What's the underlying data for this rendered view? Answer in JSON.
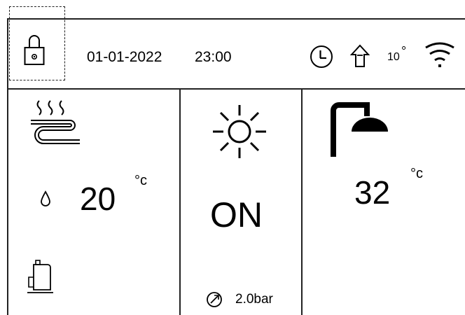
{
  "header": {
    "date": "01-01-2022",
    "time": "23:00",
    "outdoor_temp": "10",
    "outdoor_temp_unit": "°"
  },
  "panels": {
    "floor_heating": {
      "water_temp": "20",
      "unit": "°c"
    },
    "mode": {
      "status": "ON",
      "pressure": "2.0bar"
    },
    "hot_water": {
      "temp": "32",
      "unit": "°c"
    }
  },
  "icons": {
    "lock": "lock-icon",
    "clock": "clock-icon",
    "home": "home-icon",
    "wifi": "wifi-icon",
    "floor_heating": "floor-heating-icon",
    "water_drop": "water-drop-icon",
    "tank": "tank-icon",
    "sun": "sun-icon",
    "gauge": "pressure-gauge-icon",
    "shower": "shower-icon"
  }
}
